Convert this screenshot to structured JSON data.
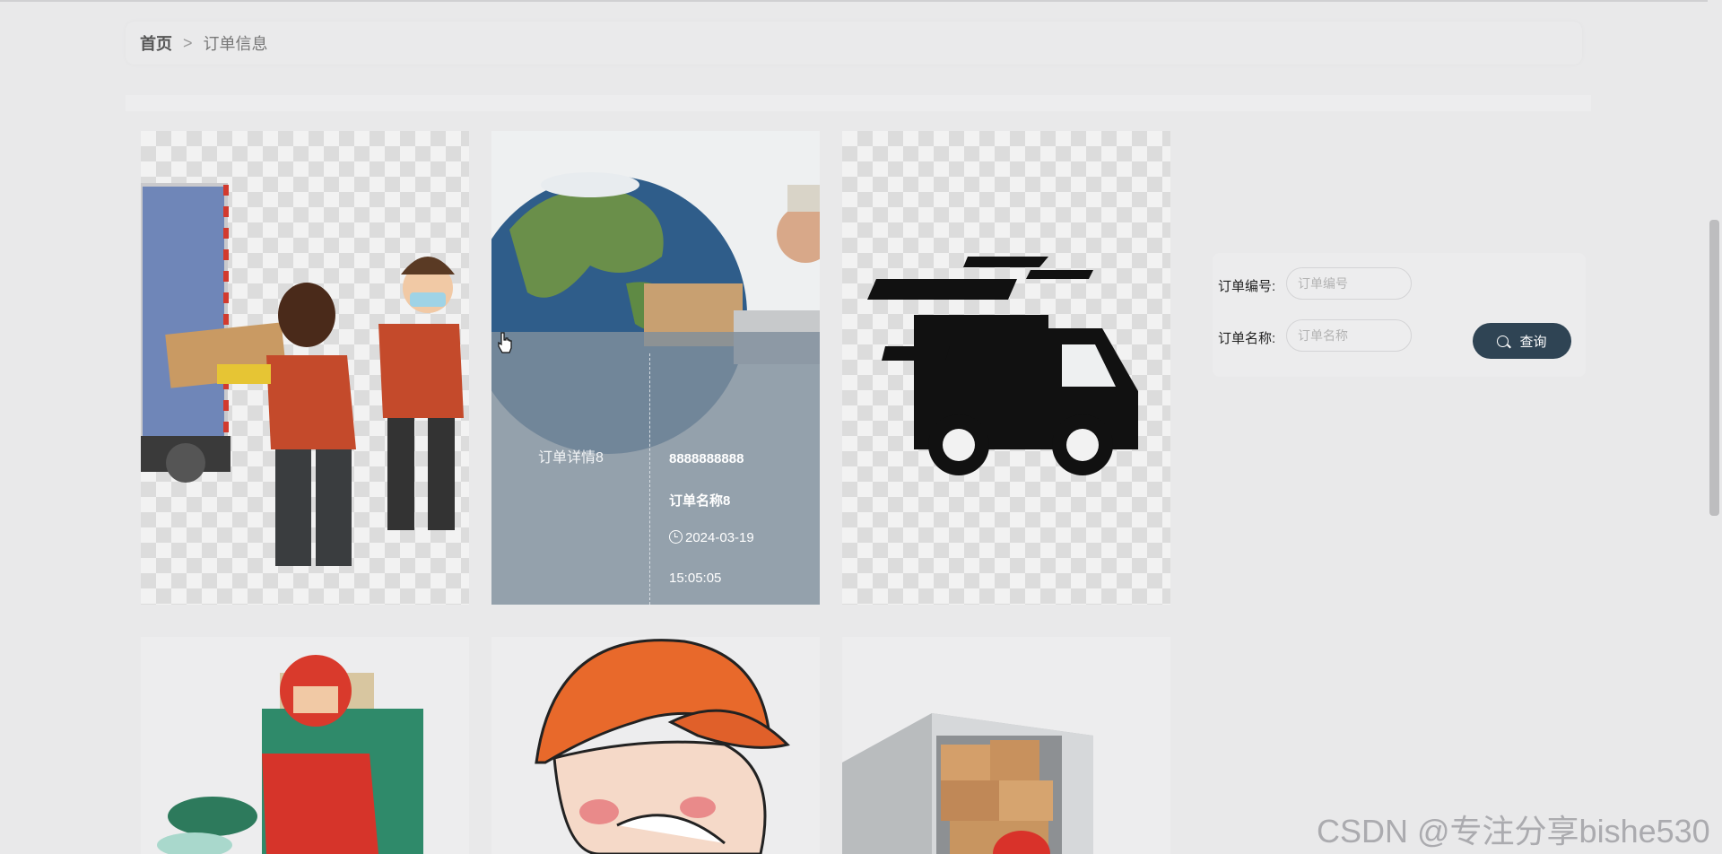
{
  "breadcrumb": {
    "home": "首页",
    "separator": ">",
    "current": "订单信息"
  },
  "hover_card": {
    "title": "订单详情8",
    "order_no": "8888888888",
    "order_name": "订单名称8",
    "date": "2024-03-19",
    "time": "15:05:05",
    "icon": "clock-icon"
  },
  "search": {
    "order_no_label": "订单编号:",
    "order_no_placeholder": "订单编号",
    "order_name_label": "订单名称:",
    "order_name_placeholder": "订单名称",
    "query_label": "查询",
    "query_icon": "search-icon",
    "button_color": "#2f4454"
  },
  "cards": [
    {
      "image": "workers-moving-box-illustration"
    },
    {
      "image": "globe-courier-photo"
    },
    {
      "image": "fast-truck-icon"
    },
    {
      "image": "scooter-delivery-illustration"
    },
    {
      "image": "courier-orange-cap-illustration"
    },
    {
      "image": "truck-boxes-photo"
    }
  ],
  "watermark": "CSDN @专注分享bishe530"
}
